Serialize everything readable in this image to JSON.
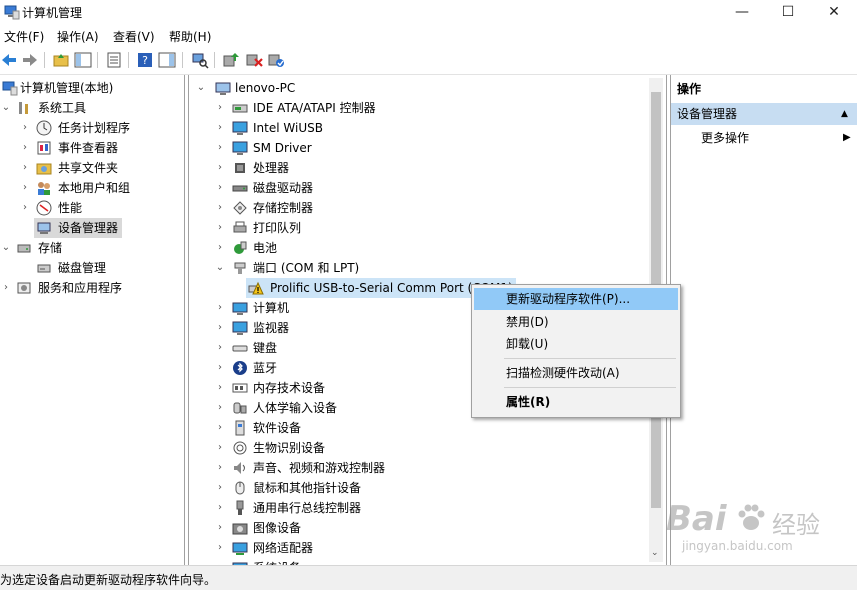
{
  "window": {
    "title": "计算机管理",
    "minimize_glyph": "—",
    "maximize_glyph": "☐",
    "close_glyph": "✕"
  },
  "menu": [
    "文件(F)",
    "操作(A)",
    "查看(V)",
    "帮助(H)"
  ],
  "left_tree": {
    "root": "计算机管理(本地)",
    "system_tools": "系统工具",
    "system_children": [
      "任务计划程序",
      "事件查看器",
      "共享文件夹",
      "本地用户和组",
      "性能",
      "设备管理器"
    ],
    "storage": "存储",
    "storage_children": [
      "磁盘管理"
    ],
    "services": "服务和应用程序"
  },
  "device_tree": {
    "root": "lenovo-PC",
    "groups_before": [
      {
        "label": "IDE ATA/ATAPI 控制器",
        "icon": "ide-controller-icon"
      },
      {
        "label": "Intel WiUSB",
        "icon": "monitor-icon"
      },
      {
        "label": "SM Driver",
        "icon": "monitor-icon"
      },
      {
        "label": "处理器",
        "icon": "processor-icon"
      },
      {
        "label": "磁盘驱动器",
        "icon": "disk-drive-icon"
      },
      {
        "label": "存储控制器",
        "icon": "storage-controller-icon"
      },
      {
        "label": "打印队列",
        "icon": "printer-icon"
      },
      {
        "label": "电池",
        "icon": "battery-icon"
      }
    ],
    "expanded_group": "端口 (COM 和 LPT)",
    "expanded_child": "Prolific USB-to-Serial Comm Port (COM1)",
    "groups_after": [
      {
        "label": "计算机",
        "icon": "computer-icon"
      },
      {
        "label": "监视器",
        "icon": "monitor-icon"
      },
      {
        "label": "键盘",
        "icon": "keyboard-icon"
      },
      {
        "label": "蓝牙",
        "icon": "bluetooth-icon"
      },
      {
        "label": "内存技术设备",
        "icon": "memory-icon"
      },
      {
        "label": "人体学输入设备",
        "icon": "hid-icon"
      },
      {
        "label": "软件设备",
        "icon": "software-device-icon"
      },
      {
        "label": "生物识别设备",
        "icon": "biometric-icon"
      },
      {
        "label": "声音、视频和游戏控制器",
        "icon": "sound-icon"
      },
      {
        "label": "鼠标和其他指针设备",
        "icon": "mouse-icon"
      },
      {
        "label": "通用串行总线控制器",
        "icon": "usb-icon"
      },
      {
        "label": "图像设备",
        "icon": "camera-icon"
      },
      {
        "label": "网络适配器",
        "icon": "network-icon"
      },
      {
        "label": "系统设备",
        "icon": "system-icon"
      }
    ]
  },
  "context_menu": {
    "update_driver": "更新驱动程序软件(P)...",
    "disable": "禁用(D)",
    "uninstall": "卸载(U)",
    "scan": "扫描检测硬件改动(A)",
    "properties": "属性(R)"
  },
  "actions": {
    "header": "操作",
    "section": "设备管理器",
    "more": "更多操作"
  },
  "status": "为选定设备启动更新驱动程序软件向导。",
  "watermark": {
    "brand_text": "Bai",
    "brand_cn": "经验",
    "domain": "jingyan.baidu.com"
  },
  "colors": {
    "selection": "#91c9f7",
    "actions_section": "#c7ddf2",
    "tree_selected": "#d9d9d9"
  }
}
